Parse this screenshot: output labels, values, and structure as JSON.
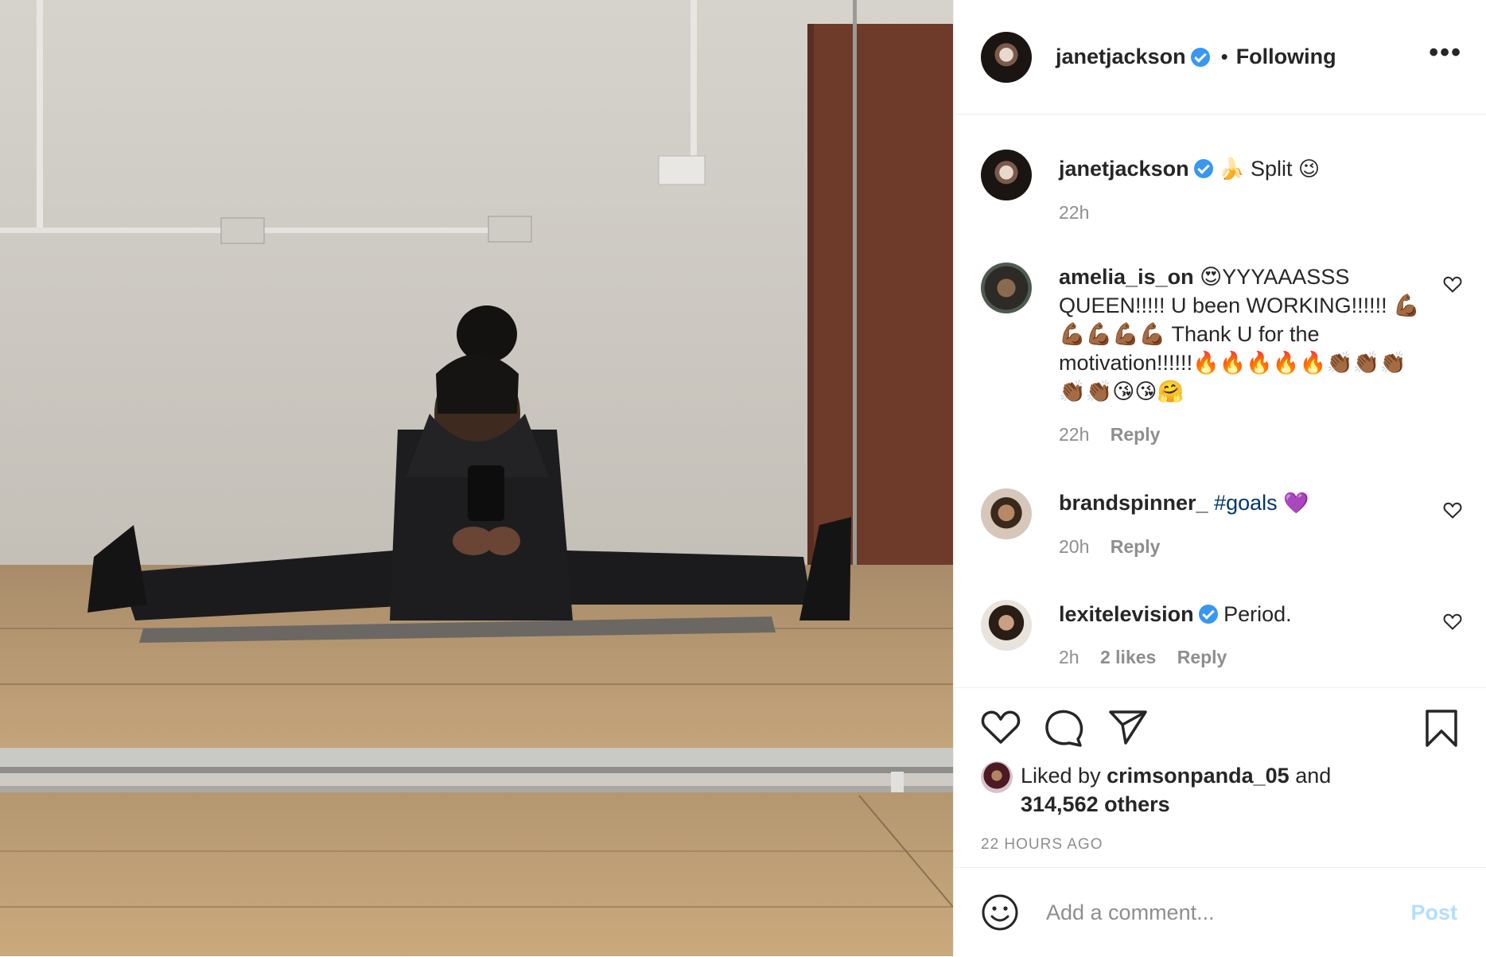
{
  "post": {
    "author": "janetjackson",
    "follow_status": "Following",
    "separator": "•",
    "more_label": "•••"
  },
  "caption": {
    "username": "janetjackson",
    "emoji_before": "🍌",
    "text": "Split",
    "emoji_after": "😉",
    "time": "22h"
  },
  "comments": [
    {
      "username": "amelia_is_on",
      "text": "😍YYYAAASSS QUEEN!!!!! U been WORKING!!!!!! 💪🏾💪🏾💪🏾💪🏾💪🏾 Thank U for the motivation!!!!!!🔥🔥🔥🔥🔥👏🏾👏🏾👏🏾👏🏾👏🏾😘😘🤗",
      "time": "22h",
      "reply": "Reply"
    },
    {
      "username": "brandspinner_",
      "text_hashtag": "#goals",
      "text_emoji": "💜",
      "time": "20h",
      "reply": "Reply"
    },
    {
      "username": "lexitelevision",
      "text": "Period.",
      "time": "2h",
      "likes": "2 likes",
      "reply": "Reply"
    }
  ],
  "likes": {
    "prefix": "Liked by",
    "user": "crimsonpanda_05",
    "and": "and",
    "others": "314,562 others"
  },
  "timestamp": "22 HOURS AGO",
  "add_comment": {
    "placeholder": "Add a comment...",
    "post_label": "Post"
  },
  "icons": {
    "like": "heart-icon",
    "comment": "comment-bubble-icon",
    "share": "paper-plane-icon",
    "save": "bookmark-icon",
    "emoji": "smiley-icon"
  },
  "colors": {
    "verified": "#3897f0",
    "link": "#00376b",
    "muted": "#8e8e8e",
    "post_disabled": "#b2dffc"
  }
}
